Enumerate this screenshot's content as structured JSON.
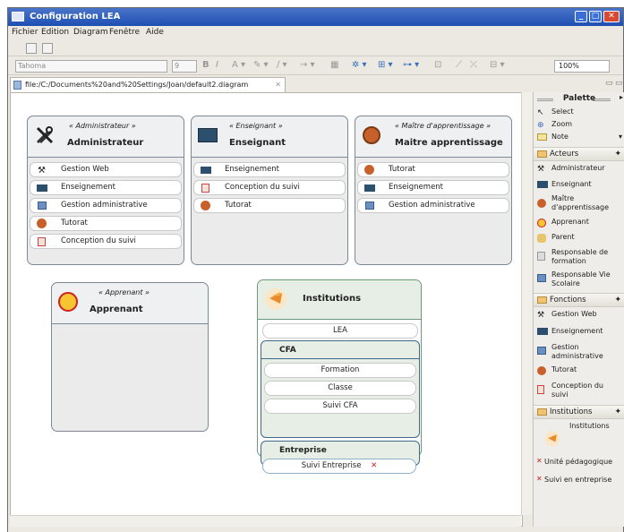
{
  "window": {
    "title": "Configuration LEA"
  },
  "menu": [
    "Fichier",
    "Edition",
    "Diagram",
    "Fenêtre",
    "Aide"
  ],
  "toolbar": {
    "font": "Tahoma",
    "size": "9",
    "zoom": "100%"
  },
  "tab": {
    "path": "file:/C:/Documents%20and%20Settings/Joan/default2.diagram"
  },
  "diagram": {
    "administrateur": {
      "stereotype": "« Administrateur »",
      "name": "Administrateur",
      "items": [
        "Gestion Web",
        "Enseignement",
        "Gestion administrative",
        "Tutorat",
        "Conception du suivi"
      ]
    },
    "enseignant": {
      "stereotype": "« Enseignant »",
      "name": "Enseignant",
      "items": [
        "Enseignement",
        "Conception du suivi",
        "Tutorat"
      ]
    },
    "maitre": {
      "stereotype": "« Maître d'apprentissage »",
      "name": "Maitre apprentissage",
      "items": [
        "Tutorat",
        "Enseignement",
        "Gestion administrative"
      ]
    },
    "apprenant": {
      "stereotype": "« Apprenant »",
      "name": "Apprenant"
    },
    "institutions": {
      "name": "Institutions",
      "top_item": "LEA",
      "cfa": {
        "title": "CFA",
        "items": [
          "Formation",
          "Classe",
          "Suivi CFA"
        ]
      },
      "entreprise": {
        "title": "Entreprise",
        "items": [
          "Suivi Entreprise"
        ]
      }
    }
  },
  "palette": {
    "title": "Palette",
    "tools": [
      "Select",
      "Zoom",
      "Note"
    ],
    "acteurs": {
      "title": "Acteurs",
      "items": [
        "Administrateur",
        "Enseignant",
        "Maître d'apprentissage",
        "Apprenant",
        "Parent",
        "Responsable de formation",
        "Responsable Vie Scolaire"
      ]
    },
    "fonctions": {
      "title": "Fonctions",
      "items": [
        "Gestion Web",
        "Enseignement",
        "Gestion administrative",
        "Tutorat",
        "Conception du suivi"
      ]
    },
    "institutions": {
      "title": "Institutions",
      "items": [
        "Institutions",
        "Unité pédagogique",
        "Suivi en entreprise"
      ]
    }
  },
  "colors": {
    "titlebar": "#1d4fb3",
    "actor_border": "#7d8896",
    "institution_border": "#6a9a7a",
    "section_border": "#3d6a8a",
    "delete_mark": "#d02020"
  }
}
